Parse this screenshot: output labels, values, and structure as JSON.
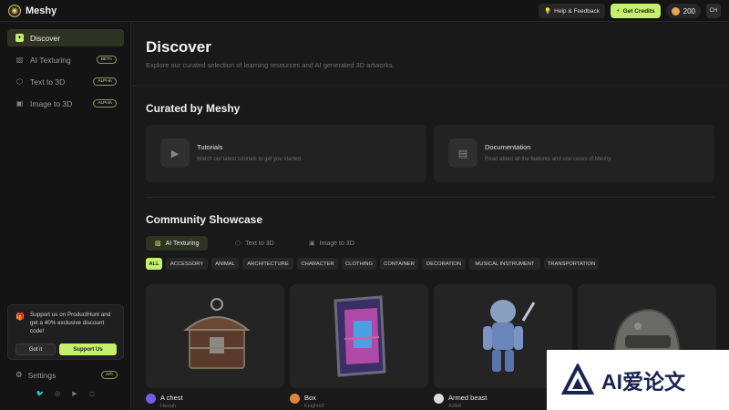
{
  "app": {
    "name": "Meshy"
  },
  "topbar": {
    "help_label": "Help & Feedback",
    "credits_label": "Get Credits",
    "balance": "200",
    "avatar_initials": "CH"
  },
  "sidebar": {
    "items": [
      {
        "label": "Discover",
        "icon": "compass-icon",
        "badge": ""
      },
      {
        "label": "AI Texturing",
        "icon": "texture-icon",
        "badge": "BETA"
      },
      {
        "label": "Text to 3D",
        "icon": "cube-icon",
        "badge": "ALPHA"
      },
      {
        "label": "Image to 3D",
        "icon": "image-icon",
        "badge": "ALPHA"
      }
    ],
    "promo": {
      "text": "Support us on ProductHunt and get a 40% exclusive discount code!",
      "got_it": "Got it",
      "support": "Support Us"
    },
    "settings_label": "Settings",
    "settings_badge": "API"
  },
  "main": {
    "title": "Discover",
    "subtitle": "Explore our curated selection of learning resources and AI generated 3D artworks.",
    "curated_title": "Curated by Meshy",
    "curated": [
      {
        "name": "Tutorials",
        "desc": "Watch our latest tutorials to get you started."
      },
      {
        "name": "Documentation",
        "desc": "Read about all the features and use cases of Meshy."
      }
    ],
    "showcase_title": "Community Showcase",
    "tabs": [
      "AI Texturing",
      "Text to 3D",
      "Image to 3D"
    ],
    "chips": [
      "ALL",
      "ACCESSORY",
      "ANIMAL",
      "ARCHITECTURE",
      "CHARACTER",
      "CLOTHING",
      "CONTAINER",
      "DECORATION",
      "MUSICAL INSTRUMENT",
      "TRANSPORTATION"
    ],
    "cards": [
      {
        "title": "A chest",
        "author": "Hexiah",
        "avatar_color": "#7a5de0"
      },
      {
        "title": "Box",
        "author": "Knight#2",
        "avatar_color": "#e0863a"
      },
      {
        "title": "Armed beast",
        "author": "AVAR",
        "avatar_color": "#dddddd"
      },
      {
        "title": "",
        "author": "",
        "avatar_color": "#444444"
      }
    ]
  },
  "watermark": {
    "text": "AI爱论文"
  }
}
